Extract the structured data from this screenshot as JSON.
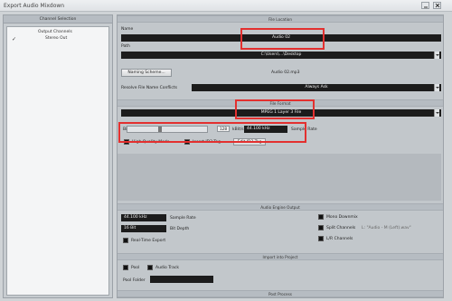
{
  "window": {
    "title": "Export Audio Mixdown"
  },
  "channel_selection": {
    "header": "Channel Selection",
    "items": [
      {
        "label": "Output Channels",
        "checked": false
      },
      {
        "label": "Stereo Out",
        "checked": true
      }
    ]
  },
  "file_location": {
    "header": "File Location",
    "name_label": "Name",
    "name_value": "Audio 02",
    "path_label": "Path",
    "path_value": "C:\\Users\\...\\Desktop",
    "naming_button": "Naming Scheme...",
    "file_preview": "Audio 02.mp3",
    "conflicts_label": "Resolve File Name Conflicts",
    "conflicts_value": "Always Ask"
  },
  "file_format": {
    "header": "File Format",
    "format_value": "MPEG 1 Layer 3 File",
    "bitrate_label": "Bit Rate",
    "bitrate_value": "128",
    "bitrate_unit": "kBit/s",
    "bitrate_level": 0.4,
    "samplerate_value": "44.100 kHz",
    "samplerate_label": "Sample Rate",
    "hq_label": "High Quality Mode",
    "id3_label": "Insert ID3 Tag",
    "id3_button": "Edit ID3 Tag"
  },
  "audio_engine": {
    "header": "Audio Engine Output",
    "rate_value": "44.100 kHz",
    "rate_label": "Sample Rate",
    "depth_value": "16 Bit",
    "depth_label": "Bit Depth",
    "realtime_label": "Real-Time Export",
    "mono_label": "Mono Downmix",
    "split_label": "Split Channels",
    "split_hint": "L: \"Audio - M (Left).wav\"",
    "lr_label": "L/R Channels"
  },
  "import_project": {
    "header": "Import into Project",
    "pool_label": "Pool",
    "audio_track_label": "Audio Track",
    "pool_folder_label": "Pool Folder"
  },
  "post_process": {
    "header": "Post Process"
  },
  "colors": {
    "highlight": "#e3302f",
    "field_dark": "#1c1c1c",
    "panel": "#c2c7cb"
  }
}
